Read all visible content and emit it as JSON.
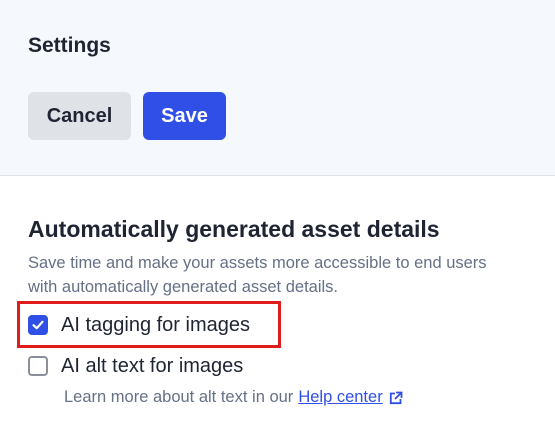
{
  "header": {
    "title": "Settings",
    "cancel_label": "Cancel",
    "save_label": "Save"
  },
  "section": {
    "title": "Automatically generated asset details",
    "description": "Save time and make your assets more accessible to end users with automatically generated asset details."
  },
  "options": [
    {
      "label": "AI tagging for images",
      "checked": true,
      "icon": "check-icon"
    },
    {
      "label": "AI alt text for images",
      "checked": false
    }
  ],
  "help": {
    "text": "Learn more about alt text in our",
    "link_label": "Help center",
    "link_icon": "external-link-icon"
  },
  "colors": {
    "accent": "#2f4fe6",
    "header_bg": "#f5f8fd",
    "highlight": "#e01b1b",
    "muted_text": "#667085"
  }
}
